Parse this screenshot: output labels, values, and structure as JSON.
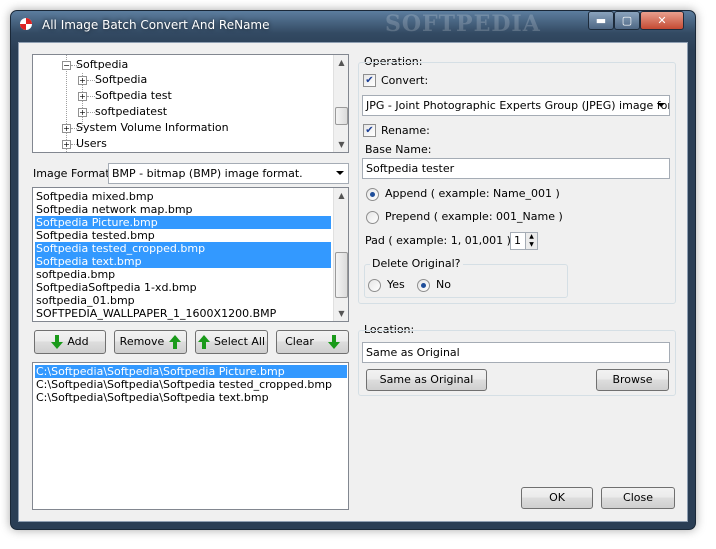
{
  "window": {
    "title": "All Image Batch Convert And ReName",
    "watermark": "SOFTPEDIA",
    "minimize_label": "▬",
    "maximize_label": "▢",
    "close_label": "✕"
  },
  "tree": {
    "items": [
      {
        "label": "Softpedia",
        "expander": "−"
      },
      {
        "label": "Softpedia",
        "expander": "+"
      },
      {
        "label": "Softpedia test",
        "expander": "+"
      },
      {
        "label": "softpediatest",
        "expander": "+"
      },
      {
        "label": "System Volume Information",
        "expander": "+"
      },
      {
        "label": "Users",
        "expander": "+"
      }
    ]
  },
  "image_format": {
    "label": "Image Format:",
    "value": "BMP - bitmap (BMP) image format."
  },
  "file_list": {
    "rows": [
      {
        "text": "Softpedia mixed.bmp",
        "selected": false
      },
      {
        "text": "Softpedia network map.bmp",
        "selected": false
      },
      {
        "text": "Softpedia Picture.bmp",
        "selected": true
      },
      {
        "text": "Softpedia tested.bmp",
        "selected": false
      },
      {
        "text": "Softpedia tested_cropped.bmp",
        "selected": true
      },
      {
        "text": "Softpedia text.bmp",
        "selected": true
      },
      {
        "text": "softpedia.bmp",
        "selected": false
      },
      {
        "text": "SoftpediaSoftpedia 1-xd.bmp",
        "selected": false
      },
      {
        "text": "softpedia_01.bmp",
        "selected": false
      },
      {
        "text": "SOFTPEDIA_WALLPAPER_1_1600X1200.BMP",
        "selected": false
      }
    ]
  },
  "buttons": {
    "add": "Add",
    "remove": "Remove",
    "select_all": "Select All",
    "clear": "Clear",
    "ok": "OK",
    "close": "Close",
    "same_as_original": "Same as Original",
    "browse": "Browse"
  },
  "queue": {
    "rows": [
      {
        "text": "C:\\Softpedia\\Softpedia\\Softpedia Picture.bmp",
        "selected": true
      },
      {
        "text": "C:\\Softpedia\\Softpedia\\Softpedia tested_cropped.bmp",
        "selected": false
      },
      {
        "text": "C:\\Softpedia\\Softpedia\\Softpedia text.bmp",
        "selected": false
      }
    ]
  },
  "operation": {
    "group_label": "Operation:",
    "convert_label": "Convert:",
    "convert_checked": true,
    "convert_format": "JPG - Joint Photographic Experts Group (JPEG) image format",
    "rename_label": "Rename:",
    "rename_checked": true,
    "base_name_label": "Base Name:",
    "base_name_value": "Softpedia tester",
    "append_label": "Append ( example: Name_001 )",
    "prepend_label": "Prepend ( example: 001_Name )",
    "append_selected": true,
    "pad_label": "Pad ( example: 1, 01,001 ):",
    "pad_value": "1",
    "delete_original_label": "Delete Original?",
    "yes_label": "Yes",
    "no_label": "No",
    "delete_selected": "No"
  },
  "location": {
    "group_label": "Location:",
    "value": "Same as Original"
  },
  "colors": {
    "selection": "#3399ff",
    "arrow_green": "#1a9a1a",
    "titlebar": "#334a63"
  }
}
